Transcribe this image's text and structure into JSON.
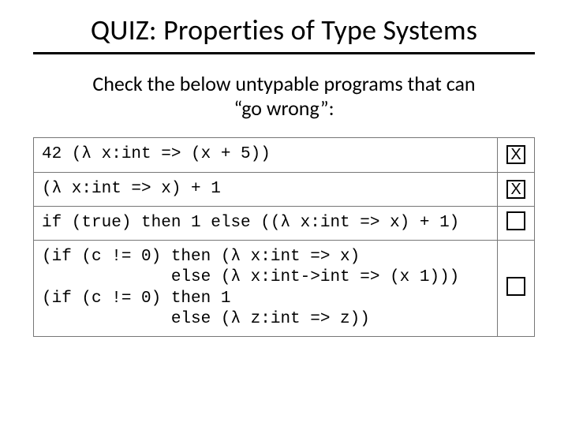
{
  "title": "QUIZ: Properties of Type Systems",
  "prompt_line1": "Check the below untypable programs that can",
  "prompt_line2": "“go wrong”:",
  "rows": [
    {
      "code": "42 (λ x:int => (x + 5))",
      "mark": "X"
    },
    {
      "code": "(λ x:int => x) + 1",
      "mark": "X"
    },
    {
      "code": "if (true) then 1 else ((λ x:int => x) + 1)",
      "mark": ""
    },
    {
      "code": "(if (c != 0) then (λ x:int => x)\n             else (λ x:int->int => (x 1)))\n(if (c != 0) then 1\n             else (λ z:int => z))",
      "mark": ""
    }
  ]
}
